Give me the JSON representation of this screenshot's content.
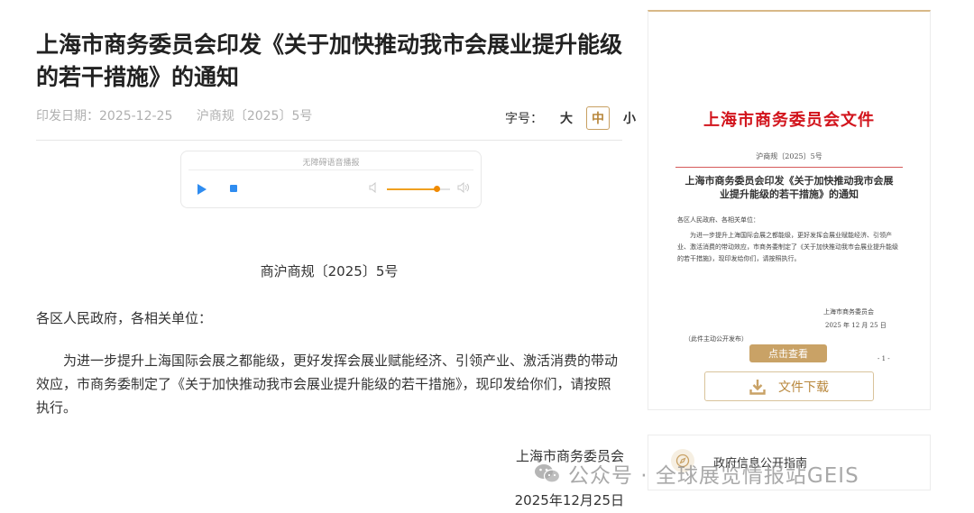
{
  "article": {
    "title": "上海市商务委员会印发《关于加快推动我市会展业提升能级的若干措施》的通知",
    "publish_date": "印发日期：2025-12-25",
    "doc_code": "沪商规〔2025〕5号",
    "font_size_label": "字号：",
    "font_size_options": [
      "大",
      "中",
      "小"
    ],
    "font_size_selected": "中",
    "doc_number_line": "商沪商规〔2025〕5号",
    "greeting": "各区人民政府，各相关单位：",
    "body": "为进一步提升上海国际会展之都能级，更好发挥会展业赋能经济、引领产业、激活消费的带动效应，市商务委制定了《关于加快推动我市会展业提升能级的若干措施》，现印发给你们，请按照执行。",
    "signature_org": "上海市商务委员会",
    "signature_date": "2025年12月25日"
  },
  "player": {
    "title": "无障碍语音播报",
    "volume_level": 0.78
  },
  "preview": {
    "red_header": "上海市商务委员会文件",
    "doc_no": "沪商规〔2025〕5号",
    "title": "上海市商务委员会印发《关于加快推动我市会展业提升能级的若干措施》的通知",
    "greeting": "各区人民政府、各相关单位：",
    "body": "为进一步提升上海国际会展之都能级，更好发挥会展业赋能经济、引领产业、激活消费的带动效应，市商务委制定了《关于加快推动我市会展业提升能级的若干措施》，现印发给你们，请按照执行。",
    "org": "上海市商务委员会",
    "date": "2025 年 12 月 25 日",
    "note": "（此件主动公开发布）",
    "page_mark": "- 1 -",
    "view_button": "点击查看",
    "download_button": "文件下载"
  },
  "guide": {
    "label": "政府信息公开指南"
  },
  "watermark": {
    "text": "公众号 · 全球展览情报站GEIS"
  },
  "colors": {
    "accent_gold": "#c9a266",
    "doc_red": "#d2141c",
    "player_blue": "#2f8cf0"
  },
  "icons": [
    "play-icon",
    "stop-icon",
    "volume-low-icon",
    "volume-high-icon",
    "download-icon",
    "compass-icon",
    "wechat-icon"
  ]
}
